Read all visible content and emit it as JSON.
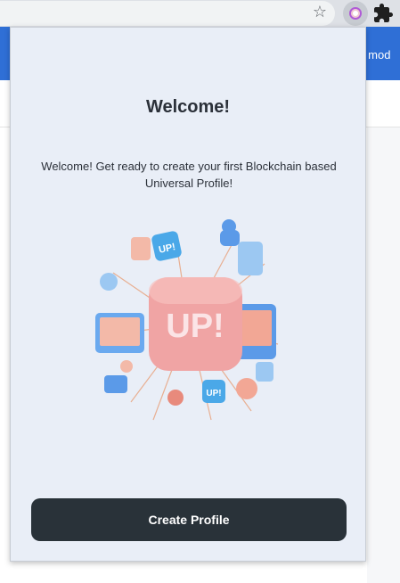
{
  "browser": {
    "bookmark_icon": "star-icon",
    "active_extension_icon": "universal-profile-extension-icon",
    "extensions_icon": "puzzle-icon",
    "page_banner_text": "er mod",
    "banner_color": "#2f6fd6"
  },
  "popup": {
    "title": "Welcome!",
    "message": "Welcome! Get ready to create your first Blockchain based Universal Profile!",
    "hero_image": {
      "icon": "up-illustration",
      "labels": [
        "UP!",
        "UP!",
        "UP!"
      ]
    },
    "create_button_label": "Create Profile",
    "background": "#e9eef7",
    "button_color": "#293239"
  }
}
